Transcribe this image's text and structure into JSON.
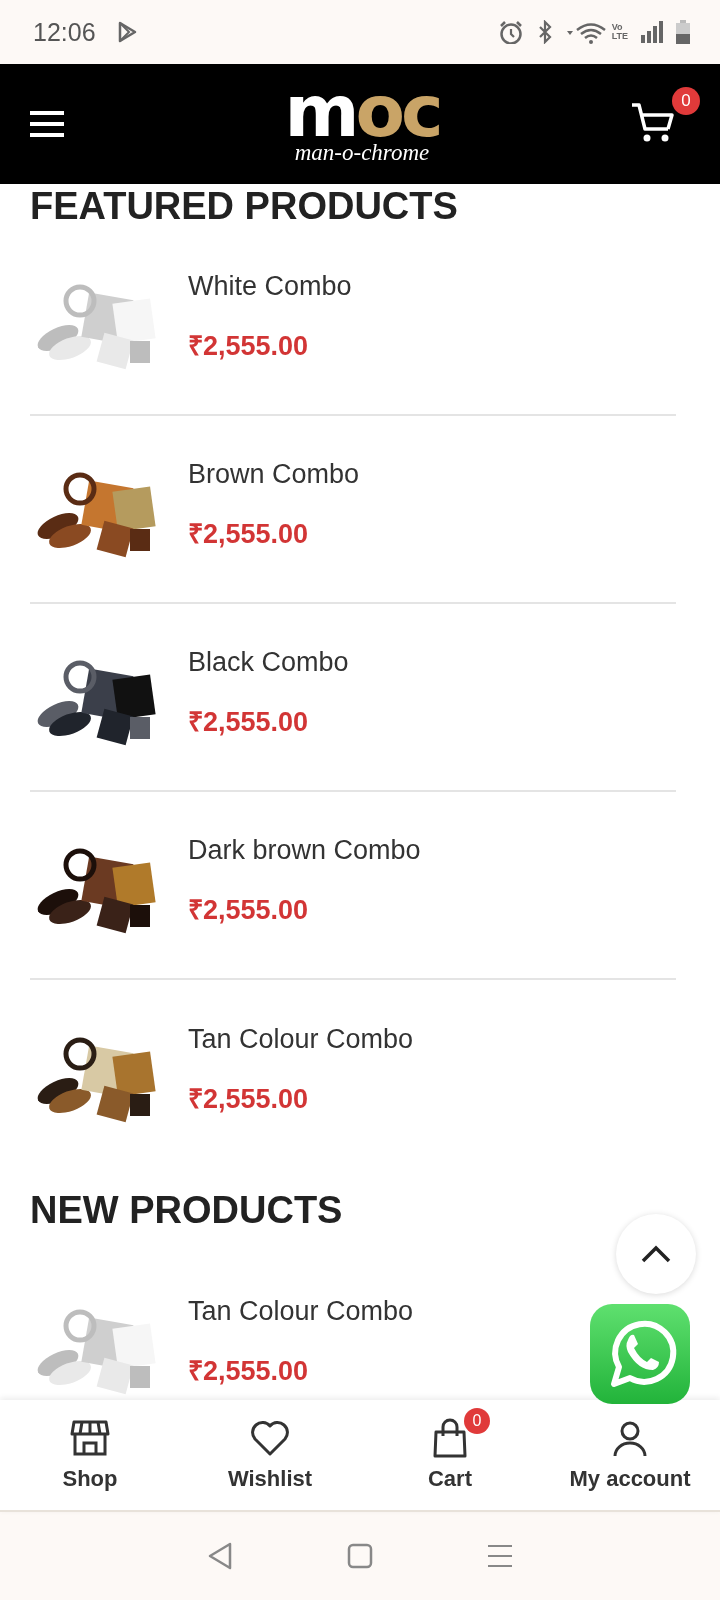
{
  "status_bar": {
    "time": "12:06",
    "volte": [
      "Vo",
      "LTE"
    ]
  },
  "header": {
    "logo": {
      "mark": [
        {
          "text": "m",
          "color": "#ffffff"
        },
        {
          "text": "oc",
          "color": "#c9a467"
        }
      ],
      "tagline": "man-o-chrome"
    },
    "cart_count": "0"
  },
  "sections": [
    {
      "title": "FEATURED PRODUCTS",
      "products": [
        {
          "name": "White Combo",
          "price": "₹2,555.00"
        },
        {
          "name": "Brown Combo",
          "price": "₹2,555.00"
        },
        {
          "name": "Black Combo",
          "price": "₹2,555.00"
        },
        {
          "name": "Dark brown Combo",
          "price": "₹2,555.00"
        },
        {
          "name": "Tan Colour Combo",
          "price": "₹2,555.00"
        }
      ]
    },
    {
      "title": "NEW PRODUCTS",
      "products": [
        {
          "name": "Tan Colour Combo",
          "price": "₹2,555.00"
        }
      ]
    }
  ],
  "bottom_nav": [
    {
      "label": "Shop"
    },
    {
      "label": "Wishlist"
    },
    {
      "label": "Cart",
      "badge": "0"
    },
    {
      "label": "My account"
    }
  ]
}
